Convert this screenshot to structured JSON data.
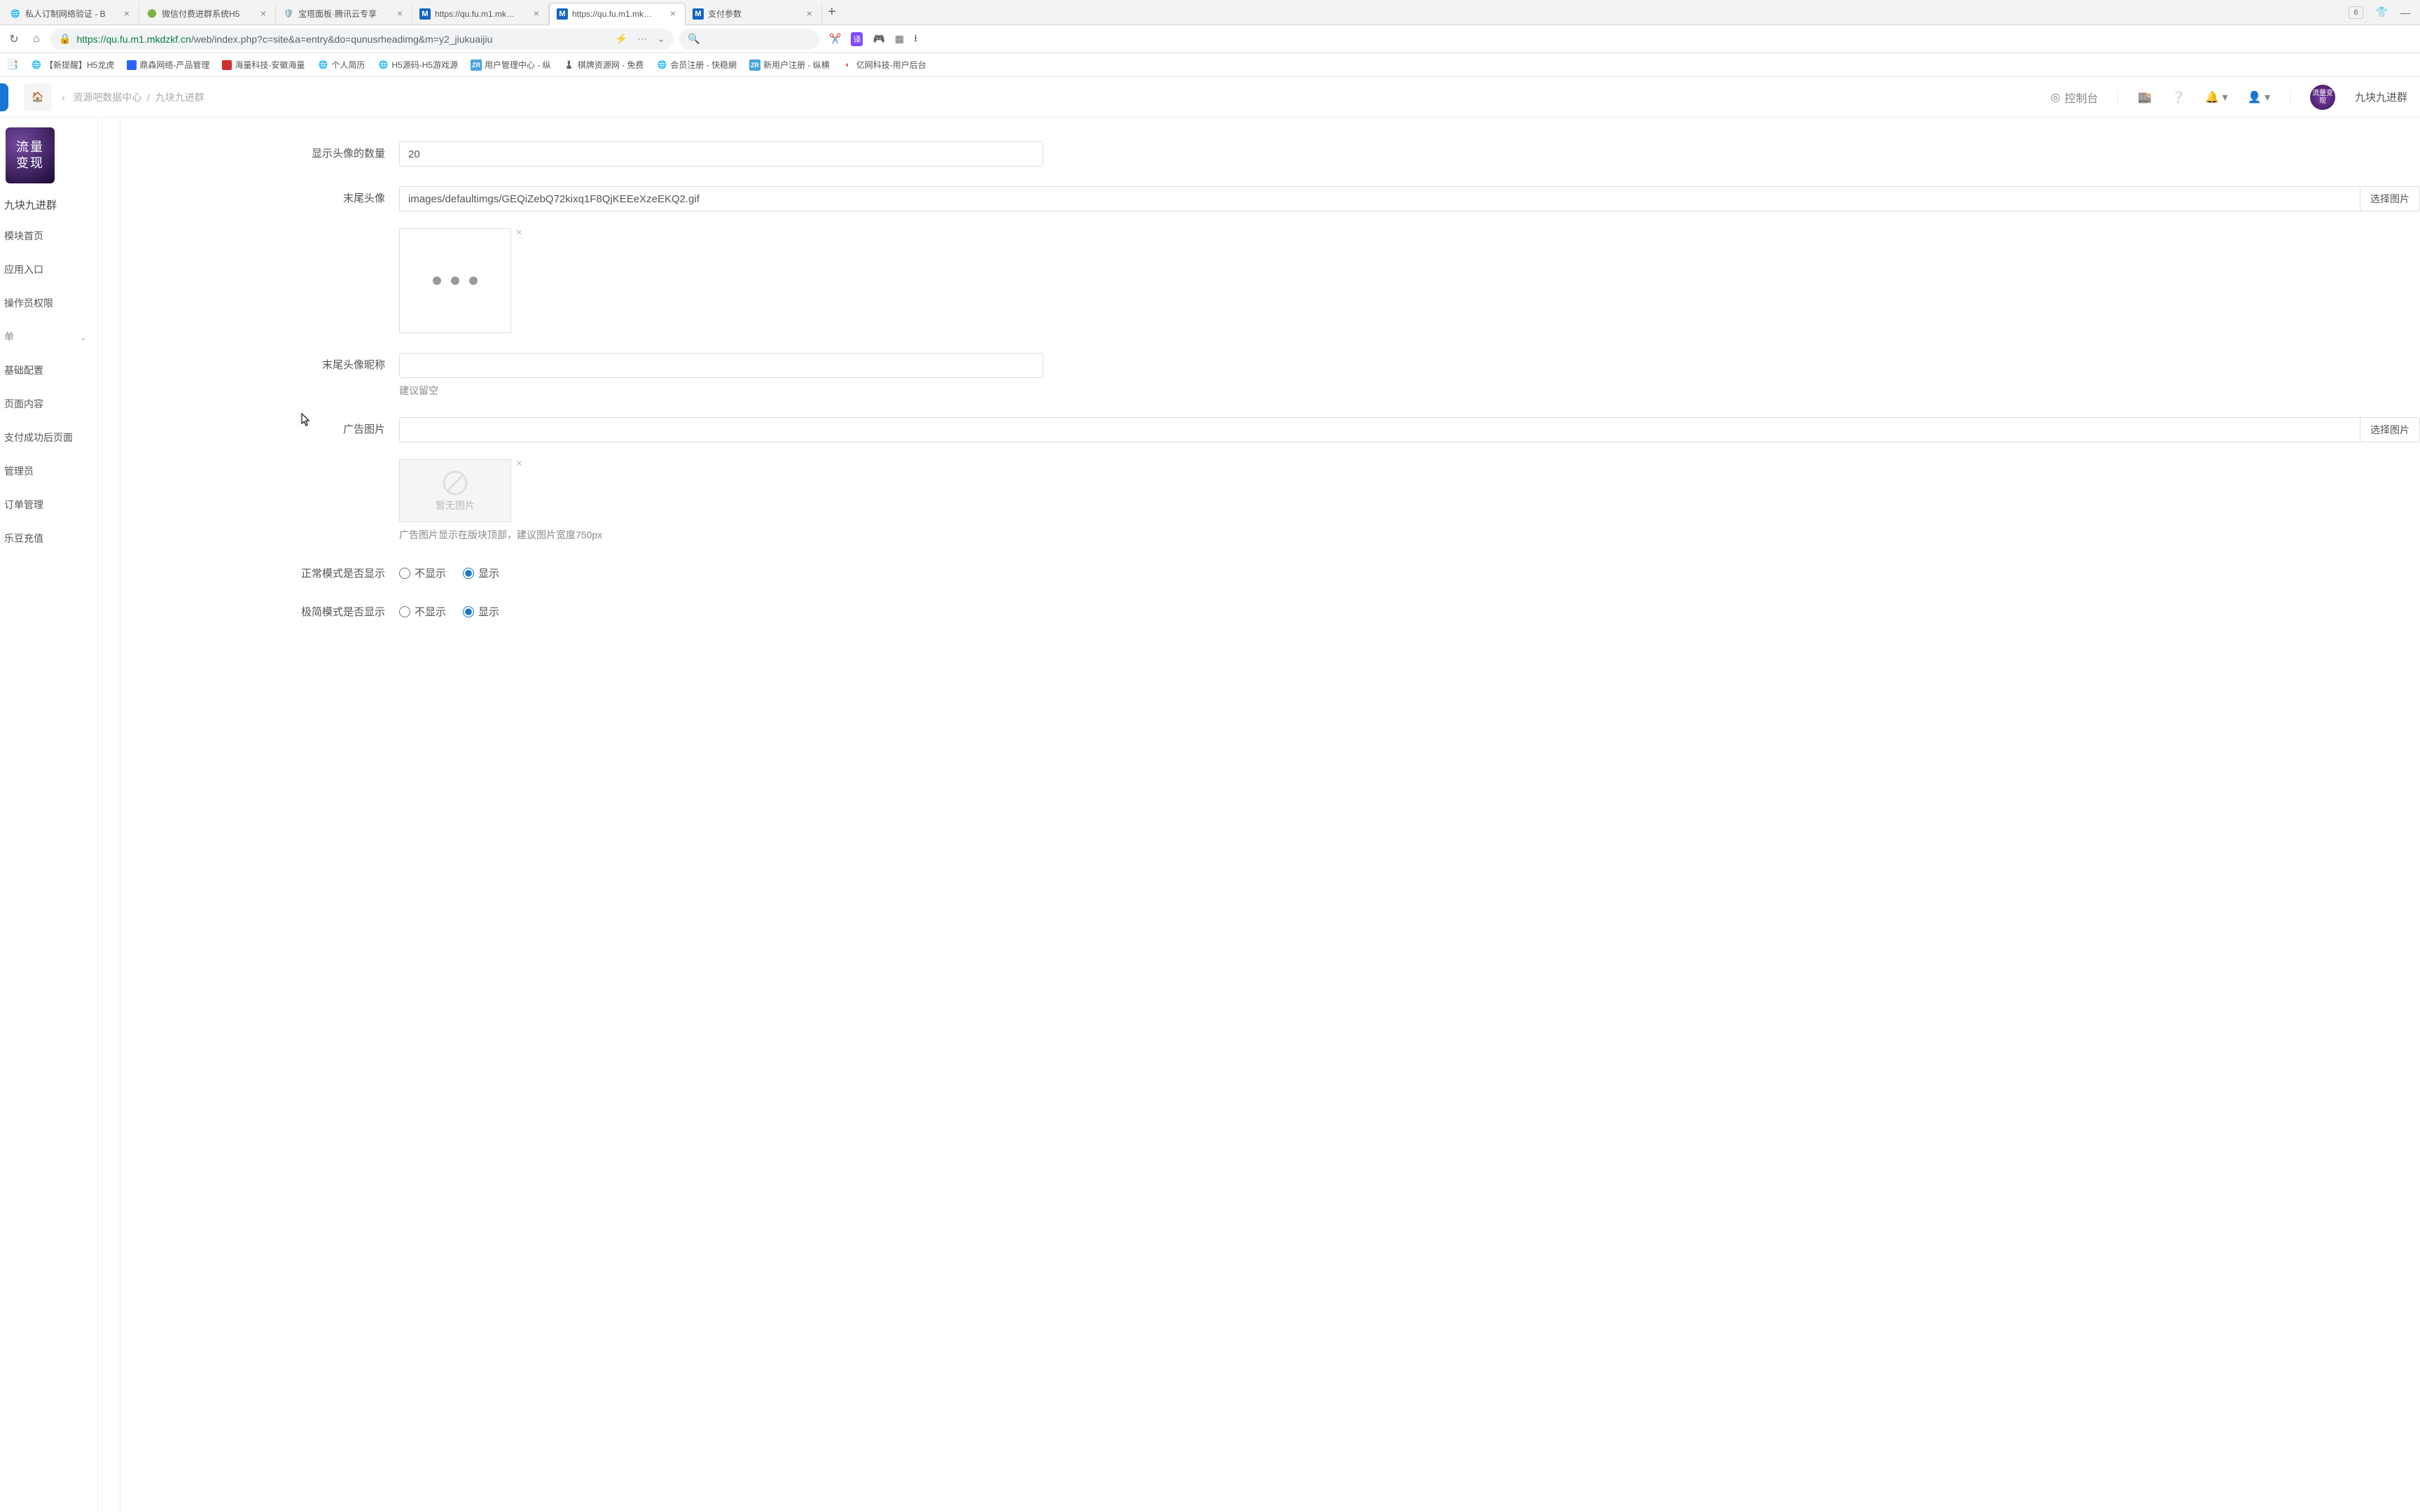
{
  "browser": {
    "tabs": [
      {
        "title": "私人订制网络验证 - B",
        "favicon": "globe"
      },
      {
        "title": "微信付费进群系统H5",
        "favicon": "wx"
      },
      {
        "title": "宝塔面板·腾讯云专享",
        "favicon": "bt"
      },
      {
        "title": "https://qu.fu.m1.mk…",
        "favicon": "m"
      },
      {
        "title": "https://qu.fu.m1.mk…",
        "favicon": "m",
        "active": true
      },
      {
        "title": "支付参数",
        "favicon": "m"
      }
    ],
    "tab_count_badge": "6",
    "url_proto": "https",
    "url_host": "://qu.fu.m1.mkdzkf.cn",
    "url_path": "/web/index.php?c=site&a=entry&do=qunusrheadimg&m=y2_jiukuaijiu"
  },
  "bookmarks": [
    {
      "label": "【新提醒】H5龙虎",
      "ico": "globe"
    },
    {
      "label": "鼎森网络-产品管理",
      "ico": "ds"
    },
    {
      "label": "海量科技-安徽海量",
      "ico": "hl"
    },
    {
      "label": "个人简历",
      "ico": "globe"
    },
    {
      "label": "H5源码-H5游戏源",
      "ico": "globe"
    },
    {
      "label": "用户管理中心 - 纵",
      "ico": "zr"
    },
    {
      "label": "棋牌资源网 - 免费",
      "ico": "qp"
    },
    {
      "label": "会员注册 - 快稳網",
      "ico": "globe"
    },
    {
      "label": "新用户注册 - 纵横",
      "ico": "zr"
    },
    {
      "label": "亿网科技-用户后台",
      "ico": "yw"
    }
  ],
  "header": {
    "breadcrumb_sep": "›",
    "breadcrumb1": "资源吧数据中心",
    "breadcrumb2": "九块九进群",
    "console": "控制台",
    "avatar_text": "流量变现",
    "site_name": "九块九进群"
  },
  "sidebar": {
    "brand_text": "流量\n变现",
    "title": "九块九进群",
    "items": [
      "模块首页",
      "应用入口",
      "操作员权限"
    ],
    "group": "单",
    "sub": [
      "基础配置",
      "页面内容",
      "支付成功后页面",
      "管理员",
      "订单管理",
      "乐豆充值"
    ]
  },
  "form": {
    "avatar_count_label": "显示头像的数量",
    "avatar_count_value": "20",
    "tail_avatar_label": "末尾头像",
    "tail_avatar_value": "images/defaultimgs/GEQiZebQ72kixq1F8QjKEEeXzeEKQ2.gif",
    "choose_img": "选择图片",
    "tail_nick_label": "末尾头像昵称",
    "tail_nick_value": "",
    "tail_nick_hint": "建议留空",
    "ad_label": "广告图片",
    "ad_value": "",
    "ad_placeholder_text": "暂无图片",
    "ad_hint": "广告图片显示在版块顶部，建议图片宽度750px",
    "normal_mode_label": "正常模式是否显示",
    "simple_mode_label": "极简模式是否显示",
    "opt_hide": "不显示",
    "opt_show": "显示"
  }
}
